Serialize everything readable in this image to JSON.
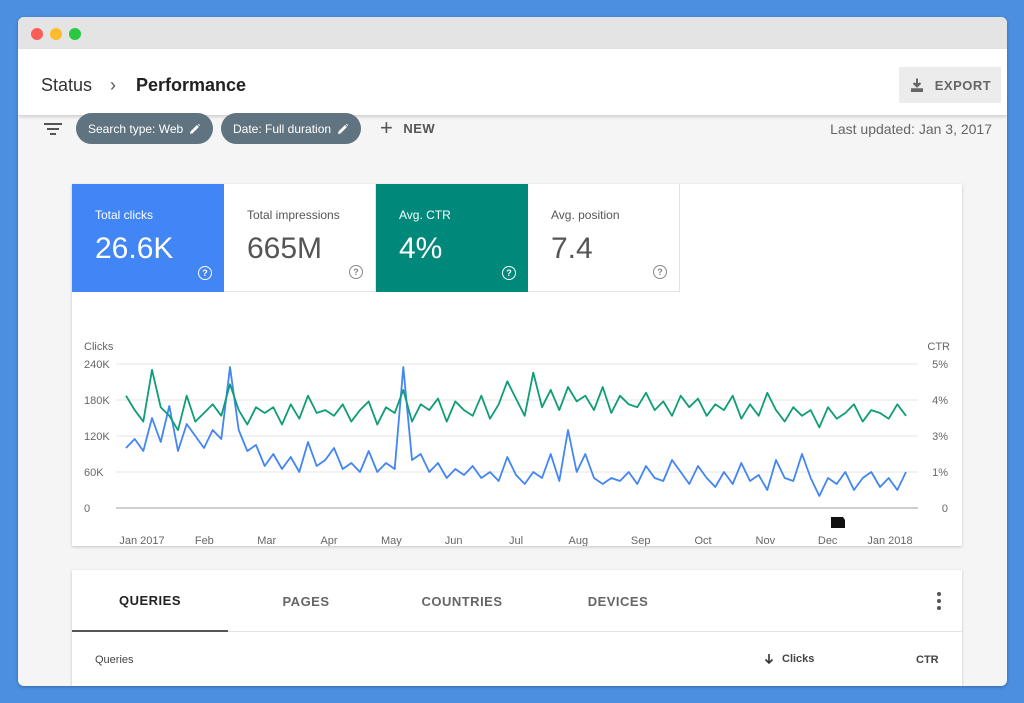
{
  "breadcrumb": {
    "parent": "Status",
    "separator": "›",
    "current": "Performance"
  },
  "header": {
    "export_label": "EXPORT",
    "export_icon": "download-icon"
  },
  "toolbar": {
    "filter_icon": "filter-icon",
    "chips": [
      {
        "label": "Search type: Web",
        "icon": "pencil-icon"
      },
      {
        "label": "Date: Full duration",
        "icon": "pencil-icon"
      }
    ],
    "new_label": "NEW",
    "last_updated": "Last updated: Jan 3, 2017"
  },
  "metrics": [
    {
      "label": "Total clicks",
      "value": "26.6K",
      "selected": true,
      "color": "#4285f4"
    },
    {
      "label": "Total impressions",
      "value": "665M",
      "selected": false
    },
    {
      "label": "Avg. CTR",
      "value": "4%",
      "selected": true,
      "color": "#00897b"
    },
    {
      "label": "Avg. position",
      "value": "7.4",
      "selected": false
    }
  ],
  "help_glyph": "?",
  "chart_data": {
    "type": "line",
    "y_left_label": "Clicks",
    "y_right_label": "CTR",
    "y_left_ticks": [
      "240K",
      "180K",
      "120K",
      "60K",
      "0"
    ],
    "y_right_ticks": [
      "5%",
      "4%",
      "3%",
      "1%",
      "0"
    ],
    "x_ticks": [
      "Jan 2017",
      "Feb",
      "Mar",
      "Apr",
      "May",
      "Jun",
      "Jul",
      "Aug",
      "Sep",
      "Oct",
      "Nov",
      "Dec",
      "Jan 2018"
    ],
    "ylim_left": [
      0,
      240000
    ],
    "ylim_right": [
      0,
      5
    ],
    "grid": true,
    "series": [
      {
        "name": "Clicks",
        "color": "#4285f4",
        "values": [
          100000,
          115000,
          95000,
          150000,
          110000,
          170000,
          95000,
          140000,
          120000,
          100000,
          130000,
          115000,
          235000,
          130000,
          95000,
          105000,
          70000,
          90000,
          65000,
          85000,
          60000,
          110000,
          70000,
          80000,
          100000,
          65000,
          75000,
          60000,
          95000,
          60000,
          75000,
          65000,
          235000,
          80000,
          90000,
          60000,
          75000,
          50000,
          65000,
          55000,
          70000,
          50000,
          60000,
          45000,
          85000,
          55000,
          40000,
          60000,
          50000,
          90000,
          45000,
          130000,
          60000,
          90000,
          50000,
          40000,
          50000,
          45000,
          60000,
          40000,
          70000,
          50000,
          45000,
          80000,
          60000,
          40000,
          70000,
          50000,
          35000,
          60000,
          40000,
          75000,
          45000,
          55000,
          30000,
          80000,
          50000,
          45000,
          90000,
          50000,
          20000,
          50000,
          40000,
          60000,
          30000,
          50000,
          60000,
          35000,
          50000,
          30000,
          60000
        ]
      },
      {
        "name": "CTR",
        "color": "#0f9d76",
        "values": [
          3.9,
          3.4,
          3.0,
          4.8,
          3.5,
          3.2,
          2.7,
          3.9,
          3.0,
          3.3,
          3.6,
          3.2,
          4.3,
          3.4,
          2.9,
          3.5,
          3.3,
          3.5,
          2.9,
          3.6,
          3.1,
          3.9,
          3.3,
          3.4,
          3.2,
          3.6,
          3.0,
          3.4,
          3.7,
          2.9,
          3.5,
          3.3,
          4.1,
          3.0,
          3.6,
          3.4,
          3.8,
          3.0,
          3.7,
          3.4,
          3.2,
          3.9,
          3.1,
          3.6,
          4.4,
          3.8,
          3.2,
          4.7,
          3.5,
          4.1,
          3.4,
          4.2,
          3.7,
          3.9,
          3.4,
          4.2,
          3.3,
          3.9,
          3.6,
          3.5,
          4.0,
          3.4,
          3.7,
          3.2,
          3.9,
          3.5,
          3.8,
          3.2,
          3.6,
          3.4,
          3.9,
          3.1,
          3.6,
          3.2,
          4.0,
          3.4,
          3.0,
          3.5,
          3.2,
          3.4,
          2.8,
          3.5,
          3.1,
          3.3,
          3.6,
          3.0,
          3.4,
          3.3,
          3.1,
          3.6,
          3.2
        ]
      }
    ]
  },
  "chart_marker_icon": "flag-icon",
  "table": {
    "tabs": [
      "QUERIES",
      "PAGES",
      "COUNTRIES",
      "DEVICES"
    ],
    "active_tab": 0,
    "menu_icon": "more-vert-icon",
    "columns": {
      "queries": "Queries",
      "clicks": "Clicks",
      "ctr": "CTR"
    },
    "sort_icon": "arrow-down-icon"
  }
}
